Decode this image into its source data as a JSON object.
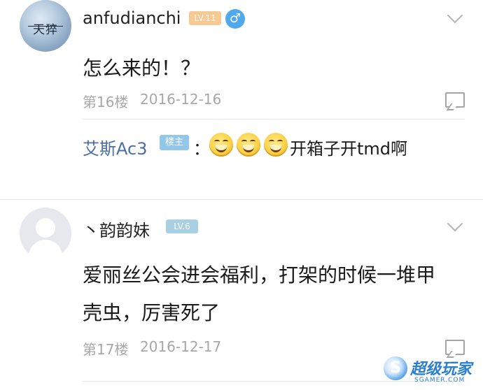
{
  "comments": [
    {
      "username": "anfudianchi",
      "avatar_text": "天猝",
      "level": "LV.11",
      "gender": "♂",
      "content": "怎么来的！？",
      "floor": "第16楼",
      "date": "2016-12-16",
      "reply": {
        "name": "艾斯Ac3",
        "badge": "楼主",
        "separator": "：",
        "text": "开箱子开tmd啊"
      }
    },
    {
      "username": "丶韵韵妹",
      "level": "LV.6",
      "content_line1": "爱丽丝公会进会福利，打架的时候一堆甲",
      "content_line2": "壳虫，厉害死了",
      "floor": "第17楼",
      "date": "2016-12-17"
    }
  ],
  "watermark": {
    "logo_glyph": "S",
    "name": "超级玩家",
    "sub": "SGAMER.COM"
  },
  "colors": {
    "level_orange": "#f7c993",
    "level_blue": "#a9cfe3",
    "male_blue": "#4fa9ec",
    "reply_name": "#4d6fa3",
    "meta_gray": "#a7a7a7"
  }
}
